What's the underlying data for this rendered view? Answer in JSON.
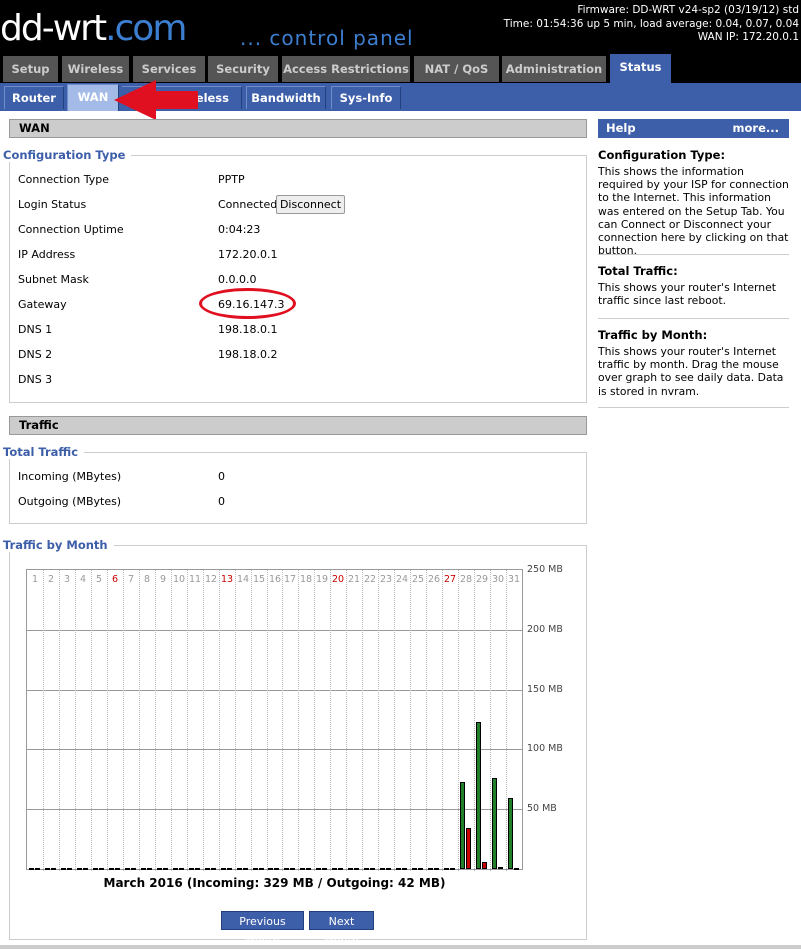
{
  "header": {
    "logo_main": "dd-wrt",
    "logo_suffix": ".com",
    "subtitle": "... control panel",
    "firmware": "Firmware: DD-WRT v24-sp2 (03/19/12) std",
    "time": "Time: 01:54:36 up 5 min, load average: 0.04, 0.07, 0.04",
    "wan_ip": "WAN IP: 172.20.0.1"
  },
  "main_tabs": [
    "Setup",
    "Wireless",
    "Services",
    "Security",
    "Access Restrictions",
    "NAT / QoS",
    "Administration",
    "Status"
  ],
  "main_active": "Status",
  "sub_tabs": [
    "Router",
    "WAN",
    "reless",
    "Bandwidth",
    "Sys-Info"
  ],
  "sub_active": "WAN",
  "wan": {
    "heading": "WAN",
    "legend": "Configuration Type",
    "rows": [
      {
        "label": "Connection Type",
        "value": "PPTP"
      },
      {
        "label": "Login Status",
        "value": "Connected"
      },
      {
        "label": "Connection Uptime",
        "value": "0:04:23"
      },
      {
        "label": "IP Address",
        "value": "172.20.0.1"
      },
      {
        "label": "Subnet Mask",
        "value": "0.0.0.0"
      },
      {
        "label": "Gateway",
        "value": "69.16.147.3"
      },
      {
        "label": "DNS 1",
        "value": "198.18.0.1"
      },
      {
        "label": "DNS 2",
        "value": "198.18.0.2"
      },
      {
        "label": "DNS 3",
        "value": ""
      }
    ],
    "disconnect_label": "Disconnect"
  },
  "traffic": {
    "heading": "Traffic",
    "legend": "Total Traffic",
    "rows": [
      {
        "label": "Incoming (MBytes)",
        "value": "0"
      },
      {
        "label": "Outgoing (MBytes)",
        "value": "0"
      }
    ],
    "month_legend": "Traffic by Month",
    "caption": "March 2016 (Incoming: 329 MB / Outgoing: 42 MB)",
    "prev_label": "Previous Month",
    "next_label": "Next Month"
  },
  "help": {
    "heading": "Help",
    "more": "more...",
    "sections": [
      {
        "title": "Configuration Type:",
        "text": "This shows the information required by your ISP for connection to the Internet. This information was entered on the Setup Tab. You can Connect or Disconnect your connection here by clicking on that button."
      },
      {
        "title": "Total Traffic:",
        "text": "This shows your router's Internet traffic since last reboot."
      },
      {
        "title": "Traffic by Month:",
        "text": "This shows your router's Internet traffic by month. Drag the mouse over graph to see daily data. Data is stored in nvram."
      }
    ]
  },
  "colors": {
    "accent": "#3d5ea8",
    "incoming": "#22802a",
    "outgoing": "#cc0000",
    "annotation": "#e01020"
  },
  "chart_data": {
    "type": "bar",
    "categories": [
      "1",
      "2",
      "3",
      "4",
      "5",
      "6",
      "7",
      "8",
      "9",
      "10",
      "11",
      "12",
      "13",
      "14",
      "15",
      "16",
      "17",
      "18",
      "19",
      "20",
      "21",
      "22",
      "23",
      "24",
      "25",
      "26",
      "27",
      "28",
      "29",
      "30",
      "31"
    ],
    "highlight_days": [
      "6",
      "13",
      "20",
      "27"
    ],
    "series": [
      {
        "name": "Incoming",
        "values": [
          0,
          0,
          0,
          0,
          0,
          0,
          0,
          0,
          0,
          0,
          0,
          0,
          0,
          0,
          0,
          0,
          0,
          0,
          0,
          0,
          0,
          0,
          0,
          0,
          0,
          0,
          0,
          73,
          123,
          76,
          59
        ]
      },
      {
        "name": "Outgoing",
        "values": [
          0,
          0,
          0,
          0,
          0,
          0,
          0,
          0,
          0,
          0,
          0,
          0,
          0,
          0,
          0,
          0,
          0,
          0,
          0,
          0,
          0,
          0,
          0,
          0,
          0,
          0,
          0,
          34,
          6,
          2,
          0
        ]
      }
    ],
    "yticks": [
      "250 MB",
      "200 MB",
      "150 MB",
      "100 MB",
      "50 MB"
    ],
    "ylim": [
      0,
      250
    ]
  }
}
